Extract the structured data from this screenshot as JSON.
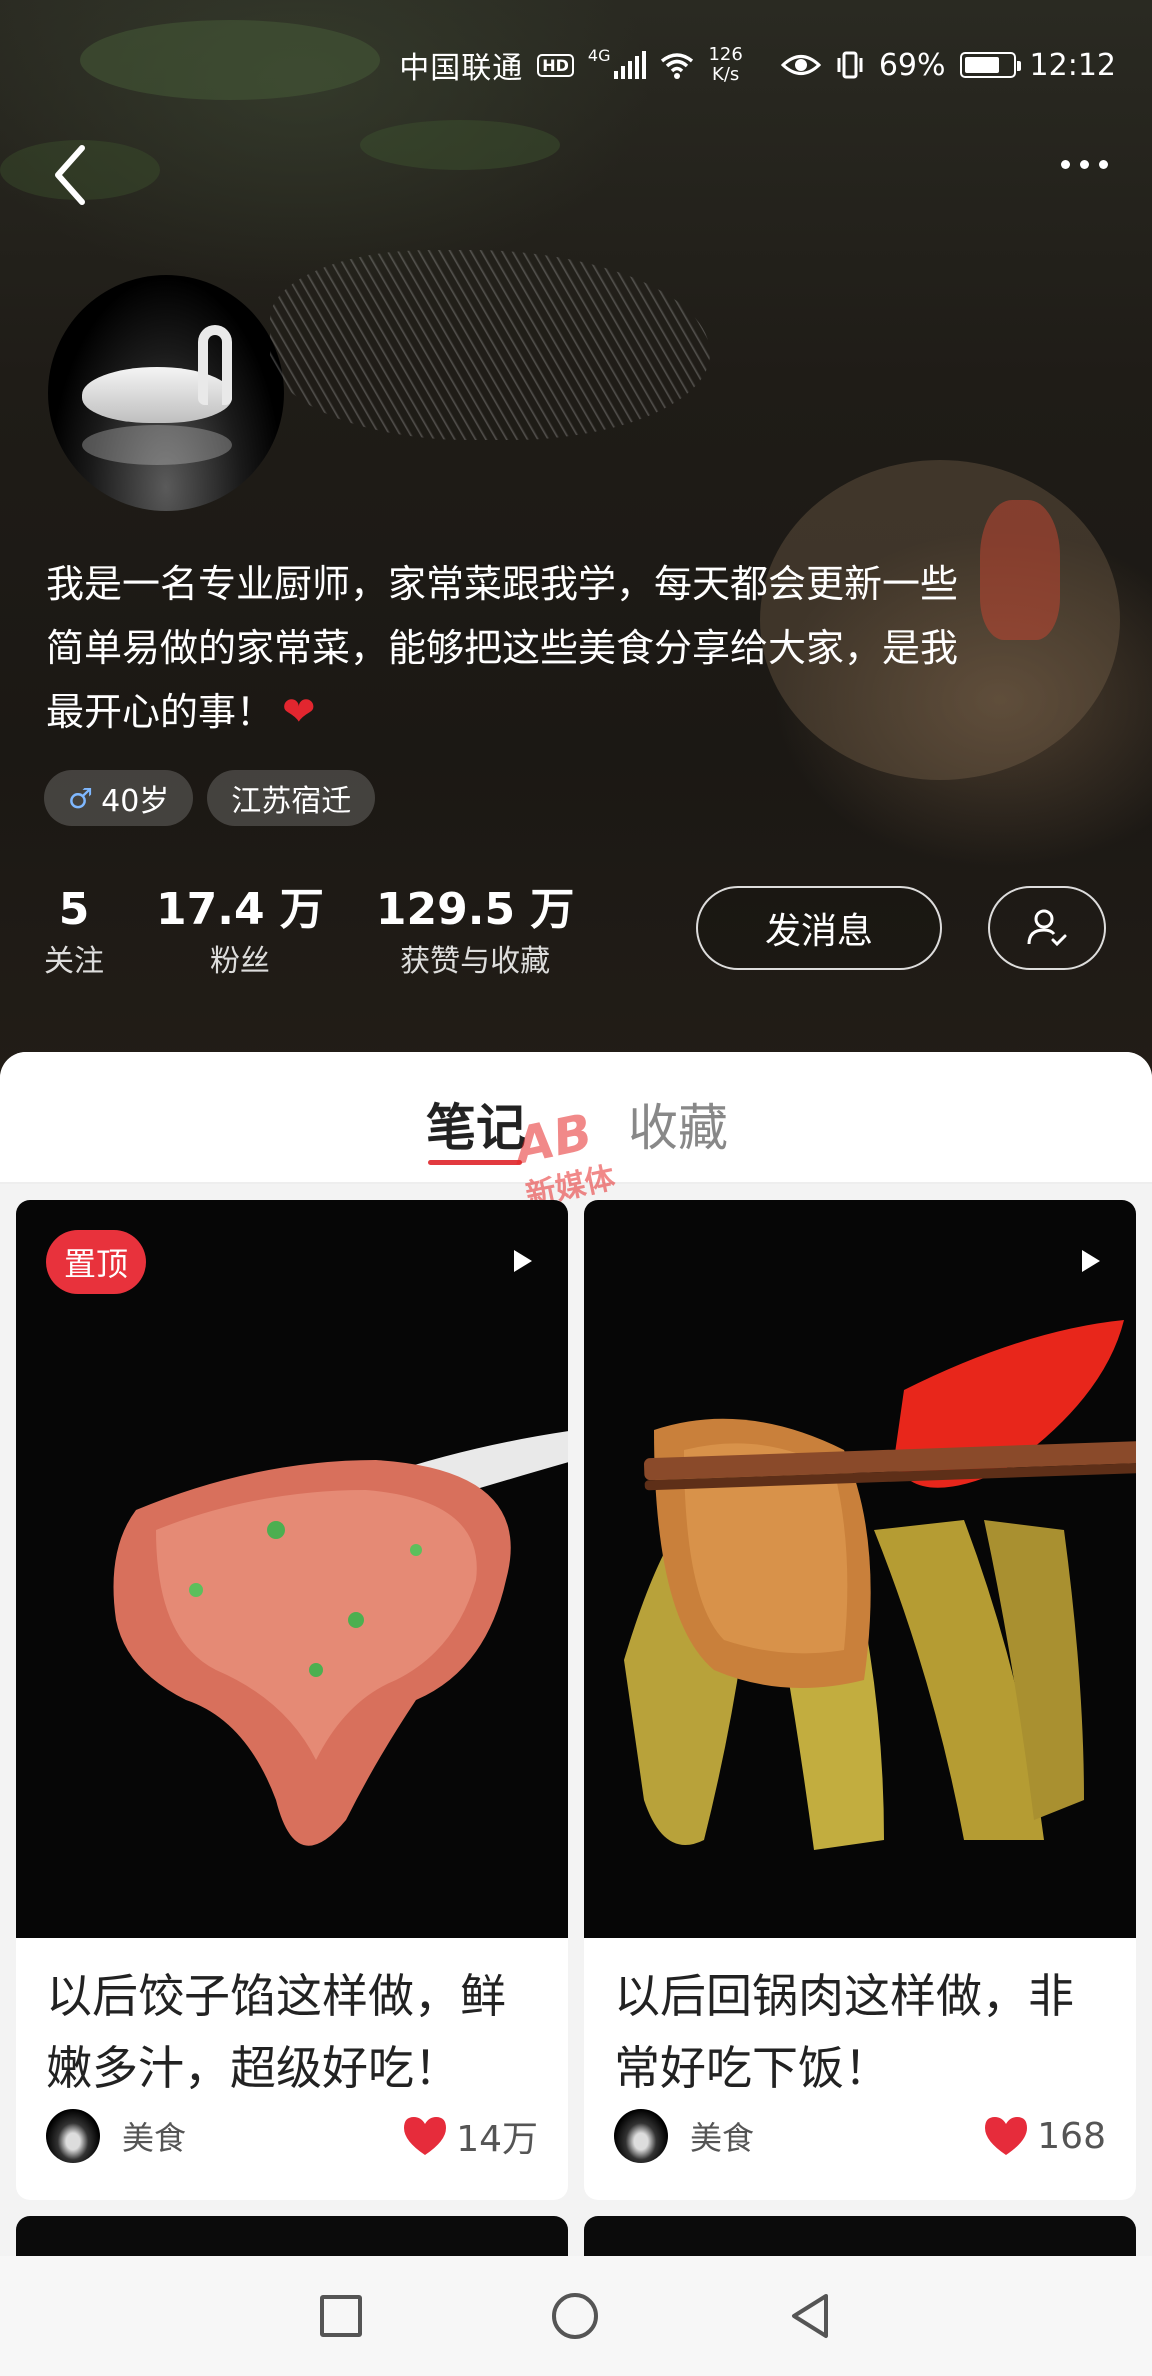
{
  "status_bar": {
    "carrier": "中国联通",
    "hd": "HD",
    "network": "4G",
    "speed_value": "126",
    "speed_unit": "K/s",
    "battery": "69%",
    "time": "12:12"
  },
  "profile": {
    "bio_lines": [
      "我是一名专业厨师，家常菜跟我学，每天都会更新一些",
      "简单易做的家常菜，能够把这些美食分享给大家，是我",
      "最开心的事！"
    ],
    "age_tag": "40岁",
    "location_tag": "江苏宿迁",
    "stats": {
      "following_num": "5",
      "following_label": "关注",
      "fans_num": "17.4 万",
      "fans_label": "粉丝",
      "likes_num": "129.5 万",
      "likes_label": "获赞与收藏"
    },
    "message_button": "发消息"
  },
  "tabs": {
    "notes": "笔记",
    "collections": "收藏"
  },
  "watermark": {
    "logo": "AB",
    "text": "新媒体"
  },
  "notes": [
    {
      "pinned_label": "置顶",
      "title_lines": [
        "以后饺子馅这样做，鲜",
        "嫩多汁，超级好吃！"
      ],
      "author": "美食",
      "likes": "14万"
    },
    {
      "title_lines": [
        "以后回锅肉这样做，非",
        "常好吃下饭！"
      ],
      "author": "美食",
      "likes": "168"
    }
  ],
  "colors": {
    "accent_red": "#e8323c",
    "heart_red": "#e62c3b"
  }
}
